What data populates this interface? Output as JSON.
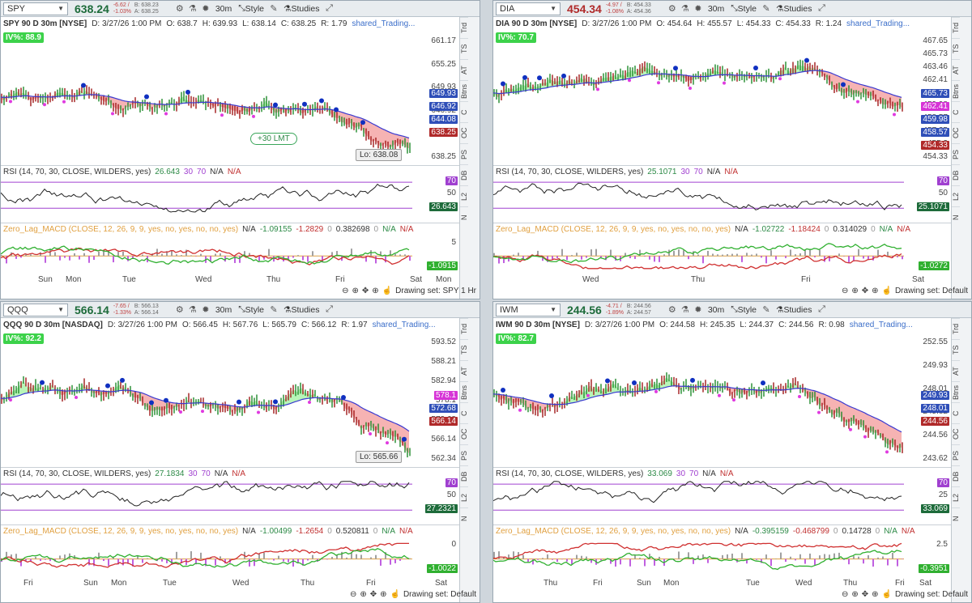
{
  "toolbar": {
    "style": "Style",
    "studies": "Studies",
    "interval": "30m"
  },
  "footer": {
    "sun": "Sun",
    "sat": "Sat",
    "mon": "Mon"
  },
  "panels": [
    {
      "symbol": "SPY",
      "price": "638.24",
      "chg": "-6.62 / -1.03%",
      "bid": "B: 638.23",
      "ask": "A: 638.25",
      "title": "SPY 90 D 30m [NYSE]",
      "date": "D: 3/27/26 1:00 PM",
      "o": "O: 638.7",
      "h": "H: 639.93",
      "l": "L: 638.14",
      "c": "C: 638.25",
      "r": "R: 1.79",
      "link": "shared_Trading...",
      "iv": "IV%: 88.9",
      "ylabels": [
        "661.17",
        "655.25",
        "649.93",
        "646.92",
        "644.08",
        "638.25"
      ],
      "tags": [
        {
          "t": "649.93",
          "c": "#2f4fb8"
        },
        {
          "t": "646.92",
          "c": "#2f4fb8"
        },
        {
          "t": "644.08",
          "c": "#2f4fb8"
        },
        {
          "t": "638.25",
          "c": "#b02a2a"
        }
      ],
      "lmt": "+30 LMT",
      "lo": "Lo: 638.08",
      "rsi": {
        "name": "RSI (14, 70, 30, CLOSE, WILDERS, yes)",
        "v": "26.643",
        "a": "30",
        "b": "70",
        "na1": "N/A",
        "na2": "N/A",
        "l70": "70",
        "l50": "50",
        "tag": "26.643"
      },
      "macd": {
        "name": "Zero_Lag_MACD (CLOSE, 12, 26, 9, 9, yes, no, yes, no, no, yes)",
        "na0": "N/A",
        "v1": "-1.09155",
        "v2": "-1.2829",
        "z": "0",
        "v3": "0.382698",
        "z2": "0",
        "na1": "N/A",
        "na2": "N/A",
        "l5": "5",
        "tag": "-1.0915"
      },
      "xticks": [
        "Sun",
        "Mon",
        "Tue",
        "Wed",
        "Thu",
        "Fri",
        "Sat",
        "Mon"
      ],
      "drawing": "Drawing set: SPY 1 Hr"
    },
    {
      "symbol": "DIA",
      "price": "454.34",
      "chg": "-4.97 / -1.08%",
      "bid": "B: 454.33",
      "ask": "A: 454.36",
      "title": "DIA 90 D 30m [NYSE]",
      "date": "D: 3/27/26 1:00 PM",
      "o": "O: 454.64",
      "h": "H: 455.57",
      "l": "L: 454.33",
      "c": "C: 454.33",
      "r": "R: 1.24",
      "link": "shared_Trading...",
      "iv": "IV%: 70.7",
      "ylabels": [
        "467.65",
        "465.73",
        "463.46",
        "462.41",
        "461.38",
        "459.98",
        "458.57",
        "457.25",
        "455.2",
        "454.33"
      ],
      "tags": [
        {
          "t": "465.73",
          "c": "#2f4fb8"
        },
        {
          "t": "462.41",
          "c": "#d633d6"
        },
        {
          "t": "459.98",
          "c": "#2f4fb8"
        },
        {
          "t": "458.57",
          "c": "#2f4fb8"
        },
        {
          "t": "454.33",
          "c": "#b02a2a"
        }
      ],
      "rsi": {
        "name": "RSI (14, 70, 30, CLOSE, WILDERS, yes)",
        "v": "25.1071",
        "a": "30",
        "b": "70",
        "na1": "N/A",
        "na2": "N/A",
        "l70": "70",
        "l50": "50",
        "tag": "25.1071"
      },
      "macd": {
        "name": "Zero_Lag_MACD (CLOSE, 12, 26, 9, 9, yes, no, yes, no, no, yes)",
        "na0": "N/A",
        "v1": "-1.02722",
        "v2": "-1.18424",
        "z": "0",
        "v3": "0.314029",
        "z2": "0",
        "na1": "N/A",
        "na2": "N/A",
        "l5": "",
        "tag": "-1.0272"
      },
      "xticks": [
        "Wed",
        "Thu",
        "Fri",
        "Sat",
        "Mon"
      ],
      "drawing": "Drawing set: Default"
    },
    {
      "symbol": "QQQ",
      "price": "566.14",
      "chg": "-7.65 / -1.33%",
      "bid": "B: 566.13",
      "ask": "A: 566.14",
      "title": "QQQ 90 D 30m [NASDAQ]",
      "date": "D: 3/27/26 1:00 PM",
      "o": "O: 566.45",
      "h": "H: 567.76",
      "l": "L: 565.79",
      "c": "C: 566.12",
      "r": "R: 1.97",
      "link": "shared_Trading...",
      "iv": "IV%: 92.2",
      "ylabels": [
        "593.52",
        "588.21",
        "582.94",
        "578.1",
        "572.68",
        "566.14",
        "562.34"
      ],
      "tags": [
        {
          "t": "578.1",
          "c": "#d633d6"
        },
        {
          "t": "572.68",
          "c": "#2f4fb8"
        },
        {
          "t": "566.14",
          "c": "#b02a2a"
        }
      ],
      "lo": "Lo: 565.66",
      "rsi": {
        "name": "RSI (14, 70, 30, CLOSE, WILDERS, yes)",
        "v": "27.1834",
        "a": "30",
        "b": "70",
        "na1": "N/A",
        "na2": "N/A",
        "l70": "70",
        "l50": "50",
        "tag": "27.2321"
      },
      "macd": {
        "name": "Zero_Lag_MACD (CLOSE, 12, 26, 9, 9, yes, no, yes, no, no, yes)",
        "na0": "N/A",
        "v1": "-1.00499",
        "v2": "-1.2654",
        "z": "0",
        "v3": "0.520811",
        "z2": "0",
        "na1": "N/A",
        "na2": "N/A",
        "l5": "0",
        "tag": "-1.0022"
      },
      "xticks": [
        "Fri",
        "Sun",
        "Mon",
        "Tue",
        "Wed",
        "Thu",
        "Fri",
        "Sat"
      ],
      "drawing": "Drawing set: Default"
    },
    {
      "symbol": "IWM",
      "price": "244.56",
      "chg": "-4.71 / -1.89%",
      "bid": "B: 244.56",
      "ask": "A: 244.57",
      "title": "IWM 90 D 30m [NYSE]",
      "date": "D: 3/27/26 1:00 PM",
      "o": "O: 244.58",
      "h": "H: 245.35",
      "l": "L: 244.37",
      "c": "C: 244.56",
      "r": "R: 0.98",
      "link": "shared_Trading...",
      "iv": "IV%: 82.7",
      "ylabels": [
        "252.55",
        "249.93",
        "248.01",
        "245.82",
        "244.56",
        "243.62"
      ],
      "tags": [
        {
          "t": "249.93",
          "c": "#2f4fb8"
        },
        {
          "t": "248.01",
          "c": "#2f4fb8"
        },
        {
          "t": "244.56",
          "c": "#b02a2a"
        }
      ],
      "rsi": {
        "name": "RSI (14, 70, 30, CLOSE, WILDERS, yes)",
        "v": "33.069",
        "a": "30",
        "b": "70",
        "na1": "N/A",
        "na2": "N/A",
        "l70": "70",
        "l50": "25",
        "tag": "33.069"
      },
      "macd": {
        "name": "Zero_Lag_MACD (CLOSE, 12, 26, 9, 9, yes, no, yes, no, no, yes)",
        "na0": "N/A",
        "v1": "-0.395159",
        "v2": "-0.468799",
        "z": "0",
        "v3": "0.14728",
        "z2": "0",
        "na1": "N/A",
        "na2": "N/A",
        "l5": "2.5",
        "tag": "-0.3951"
      },
      "xticks": [
        "Thu",
        "Fri",
        "Sun",
        "Mon",
        "Tue",
        "Wed",
        "Thu",
        "Fri",
        "Sat",
        "Mon"
      ],
      "drawing": "Drawing set: Default"
    }
  ],
  "side": [
    "Trd",
    "TS",
    "AT",
    "Btns",
    "C",
    "OC",
    "PS",
    "DB",
    "L2",
    "N"
  ]
}
